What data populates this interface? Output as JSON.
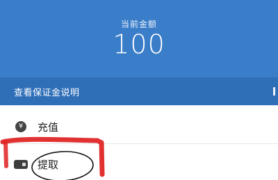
{
  "balance": {
    "label": "当前金额",
    "amount": "100"
  },
  "deposit_info": {
    "label": "查看保证金说明"
  },
  "menu": {
    "recharge": {
      "label": "充值",
      "icon": "yen-icon"
    },
    "withdraw": {
      "label": "提取",
      "icon": "card-icon"
    }
  },
  "colors": {
    "header": "#3a7dc9",
    "bar": "#2f6fb8",
    "annotation_red": "#e02020"
  }
}
